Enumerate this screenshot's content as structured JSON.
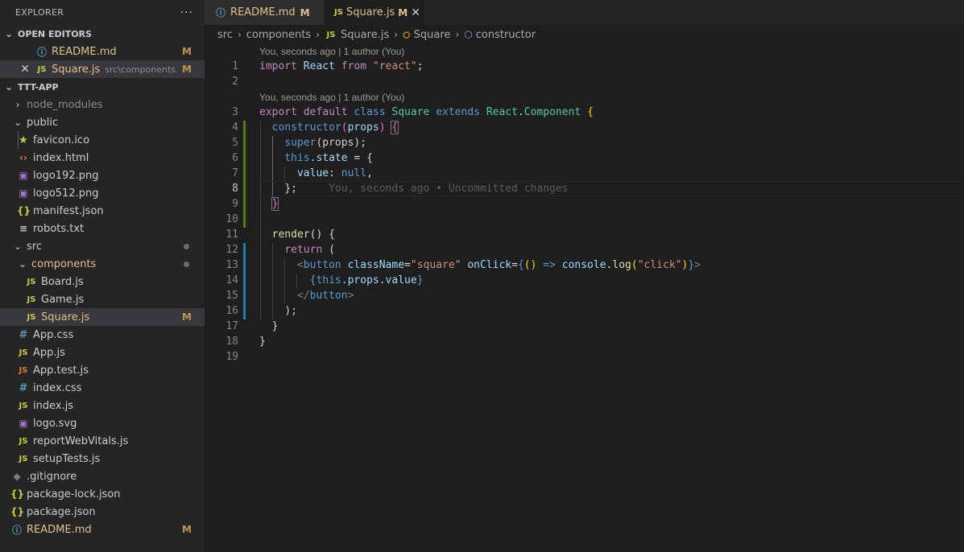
{
  "sidebar": {
    "title": "EXPLORER",
    "more": "···",
    "open_editors_label": "OPEN EDITORS",
    "open_editors": [
      {
        "name": "README.md",
        "badge": "M",
        "icon": "info-icon"
      },
      {
        "name": "Square.js",
        "extra": "src\\components",
        "badge": "M",
        "icon": "js-icon",
        "close": "✕"
      }
    ],
    "project_label": "TTT-APP",
    "tree": [
      {
        "name": "node_modules"
      },
      {
        "name": "public"
      },
      {
        "name": "favicon.ico"
      },
      {
        "name": "index.html"
      },
      {
        "name": "logo192.png"
      },
      {
        "name": "logo512.png"
      },
      {
        "name": "manifest.json"
      },
      {
        "name": "robots.txt"
      },
      {
        "name": "src"
      },
      {
        "name": "components"
      },
      {
        "name": "Board.js"
      },
      {
        "name": "Game.js"
      },
      {
        "name": "Square.js",
        "badge": "M"
      },
      {
        "name": "App.css"
      },
      {
        "name": "App.js"
      },
      {
        "name": "App.test.js"
      },
      {
        "name": "index.css"
      },
      {
        "name": "index.js"
      },
      {
        "name": "logo.svg"
      },
      {
        "name": "reportWebVitals.js"
      },
      {
        "name": "setupTests.js"
      },
      {
        "name": ".gitignore"
      },
      {
        "name": "package-lock.json"
      },
      {
        "name": "package.json"
      },
      {
        "name": "README.md",
        "badge": "M"
      }
    ]
  },
  "tabs": [
    {
      "name": "README.md",
      "badge": "M",
      "active": false
    },
    {
      "name": "Square.js",
      "badge": "M",
      "active": true,
      "close": "✕"
    }
  ],
  "breadcrumb": {
    "parts": [
      "src",
      "components",
      "Square.js",
      "Square",
      "constructor"
    ]
  },
  "editor": {
    "codelens": [
      "You, seconds ago | 1 author (You)",
      "You, seconds ago | 1 author (You)"
    ],
    "line_numbers": [
      "1",
      "2",
      "3",
      "4",
      "5",
      "6",
      "7",
      "8",
      "9",
      "10",
      "11",
      "12",
      "13",
      "14",
      "15",
      "16",
      "17",
      "18",
      "19"
    ],
    "current_line": "8",
    "blame_text": "You, seconds ago • Uncommitted changes",
    "tokens": {
      "import": "import",
      "React": "React",
      "from": "from",
      "react_str": "\"react\"",
      "semi": ";",
      "export": "export",
      "default": "default",
      "class": "class",
      "Square": "Square",
      "extends": "extends",
      "React2": "React",
      ".": ".",
      "Component": "Component",
      "lbrace": "{",
      "constructor": "constructor",
      "lp": "(",
      "props": "props",
      "rp": ")",
      "super": "super",
      "propsarg": "(props);",
      "this": "this",
      "state": ".state",
      "eq": " = {",
      "value": "value",
      "colon": ": ",
      "null": "null",
      "comma": ",",
      "closeobj": "};",
      "closebrace": "}",
      "render": "render",
      "parens": "() {",
      "return": "return",
      "returnparen": " (",
      "lt": "<",
      "button": "button",
      "className": "className",
      "eq2": "=",
      "square_str": "\"square\"",
      "onClick": "onClick",
      "eq3": "=",
      "lb": "{",
      "arrowparens": "()",
      "arrow": " =>",
      "console": "console",
      "log": "log",
      "click_str": "\"click\"",
      "rb": "}",
      "gt": ">",
      "lb2": "{",
      "this2": "this",
      "propsval": ".props.value",
      "rb2": "}",
      "endtag_open": "</",
      "button2": "button",
      "endtag_close": ">",
      "closeparen": ");",
      "close1": "}",
      "close2": "}"
    }
  },
  "colors": {
    "modified": "#e2c08d",
    "accent": "#007acc",
    "gutter_added": "#587c0c",
    "gutter_modified": "#1b81a8"
  }
}
